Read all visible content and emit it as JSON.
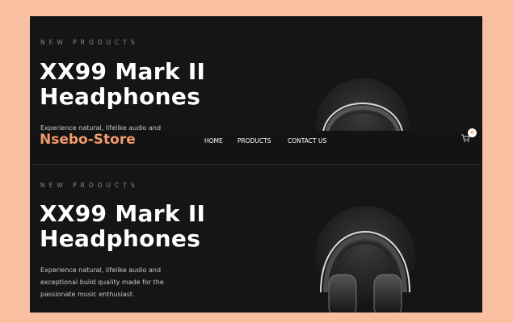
{
  "hero_top": {
    "eyebrow": "NEW PRODUCTS",
    "title_line1": "XX99 Mark II",
    "title_line2": "Headphones",
    "description": "Experience natural, lifelike audio and"
  },
  "navbar": {
    "logo": "Nsebo-Store",
    "links": [
      "HOME",
      "PRODUCTS",
      "CONTACT US"
    ],
    "cart_count": "0",
    "icon": "cart-icon"
  },
  "hero_bottom": {
    "eyebrow": "NEW PRODUCTS",
    "title_line1": "XX99 Mark II",
    "title_line2": "Headphones",
    "description_lines": [
      "Experience natural, lifelike audio and",
      "exceptional build quality made for the",
      "passionate music enthusiast."
    ]
  },
  "colors": {
    "page_background": "#F8BFA0",
    "accent": "#F39A6B",
    "hero_background": "#151515"
  }
}
